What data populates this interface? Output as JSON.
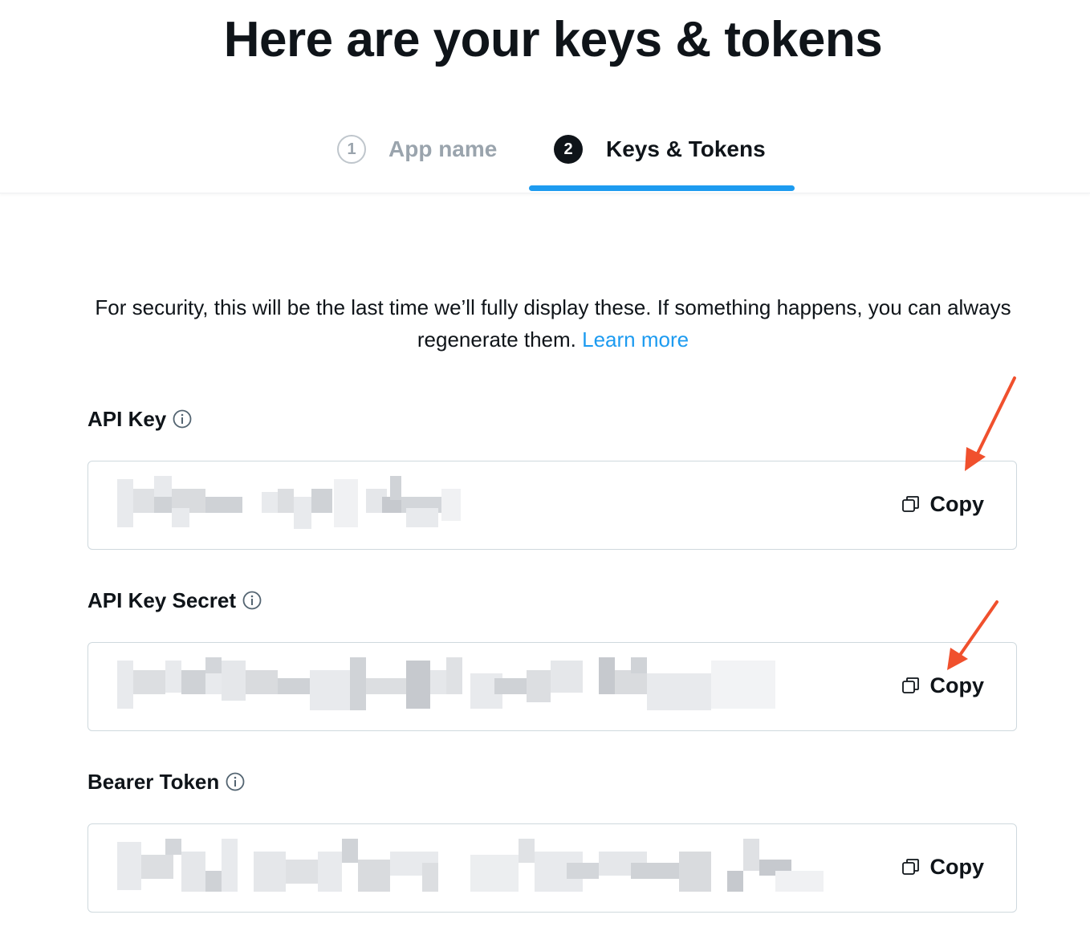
{
  "page": {
    "title": "Here are your keys & tokens"
  },
  "stepper": {
    "steps": [
      {
        "number": "1",
        "label": "App name"
      },
      {
        "number": "2",
        "label": "Keys & Tokens"
      }
    ],
    "active_step": 2
  },
  "notice": {
    "text": "For security, this will be the last time we’ll fully display these. If something happens, you can always regenerate them.",
    "link": "Learn more"
  },
  "fields": [
    {
      "label": "API Key",
      "copy_label": "Copy",
      "value_redacted": true
    },
    {
      "label": "API Key Secret",
      "copy_label": "Copy",
      "value_redacted": true
    },
    {
      "label": "Bearer Token",
      "copy_label": "Copy",
      "value_redacted": true
    }
  ],
  "colors": {
    "accent": "#1d9bf0",
    "text": "#0f1419",
    "muted": "#9aa4ad",
    "border": "#cfd9de",
    "annotation_arrow": "#f0502d"
  },
  "icons": [
    "info-icon",
    "copy-icon",
    "annotation-arrow"
  ]
}
